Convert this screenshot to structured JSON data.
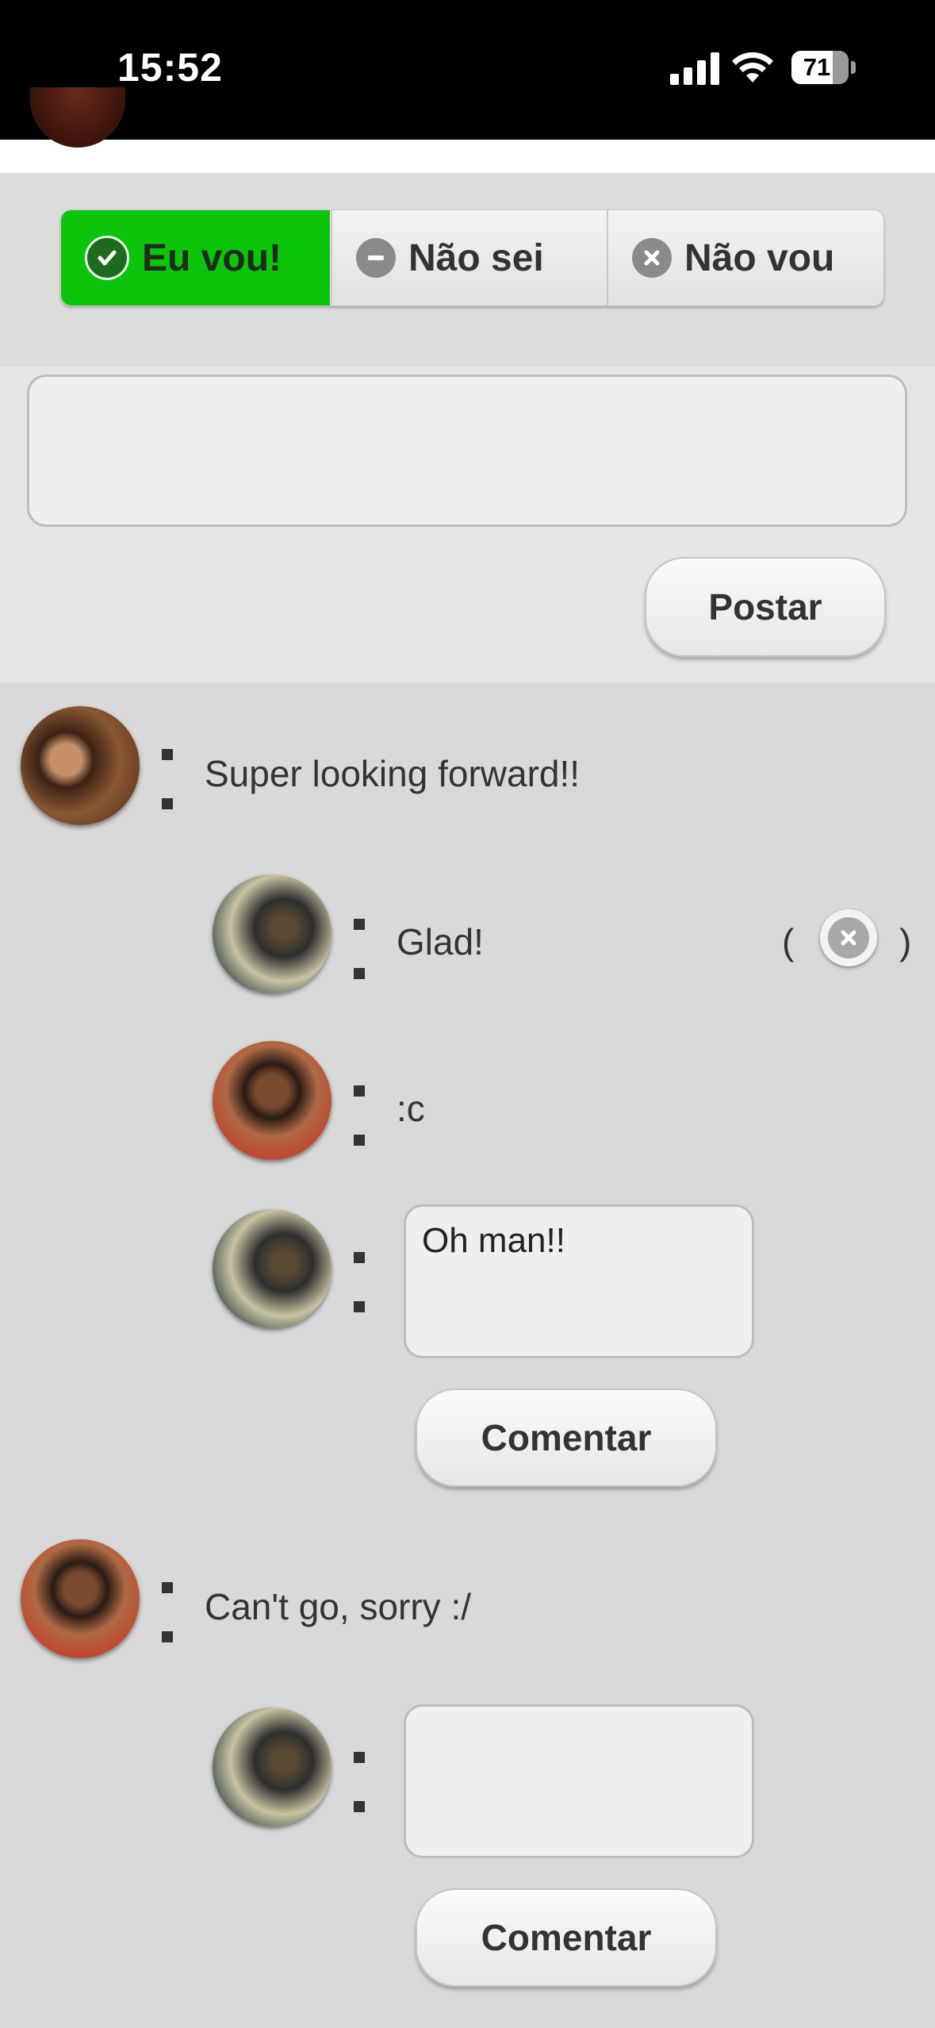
{
  "status_bar": {
    "time": "15:52",
    "battery": "71"
  },
  "rsvp": {
    "selected": "yes",
    "options": [
      {
        "id": "yes",
        "label": "Eu vou!",
        "icon": "check-circle-icon"
      },
      {
        "id": "maybe",
        "label": "Não sei",
        "icon": "minus-circle-icon"
      },
      {
        "id": "no",
        "label": "Não vou",
        "icon": "x-circle-icon"
      }
    ],
    "colors": {
      "selected_bg": "#0bc40b"
    }
  },
  "composer": {
    "value": "",
    "post_label": "Postar"
  },
  "comments": [
    {
      "text": "Super looking forward!!",
      "avatar": "avatar-woman",
      "replies": [
        {
          "text": "Glad!",
          "avatar": "avatar-man-glasses",
          "deletable": true
        },
        {
          "text": ":c",
          "avatar": "avatar-man-red-shirt"
        }
      ],
      "reply_box": {
        "value": "Oh man!!",
        "button_label": "Comentar"
      }
    },
    {
      "text": "Can't go, sorry :/",
      "avatar": "avatar-man-red-shirt",
      "replies": [],
      "reply_box": {
        "value": "",
        "button_label": "Comentar"
      }
    }
  ],
  "delete_control": {
    "open": "(",
    "close": ")"
  }
}
